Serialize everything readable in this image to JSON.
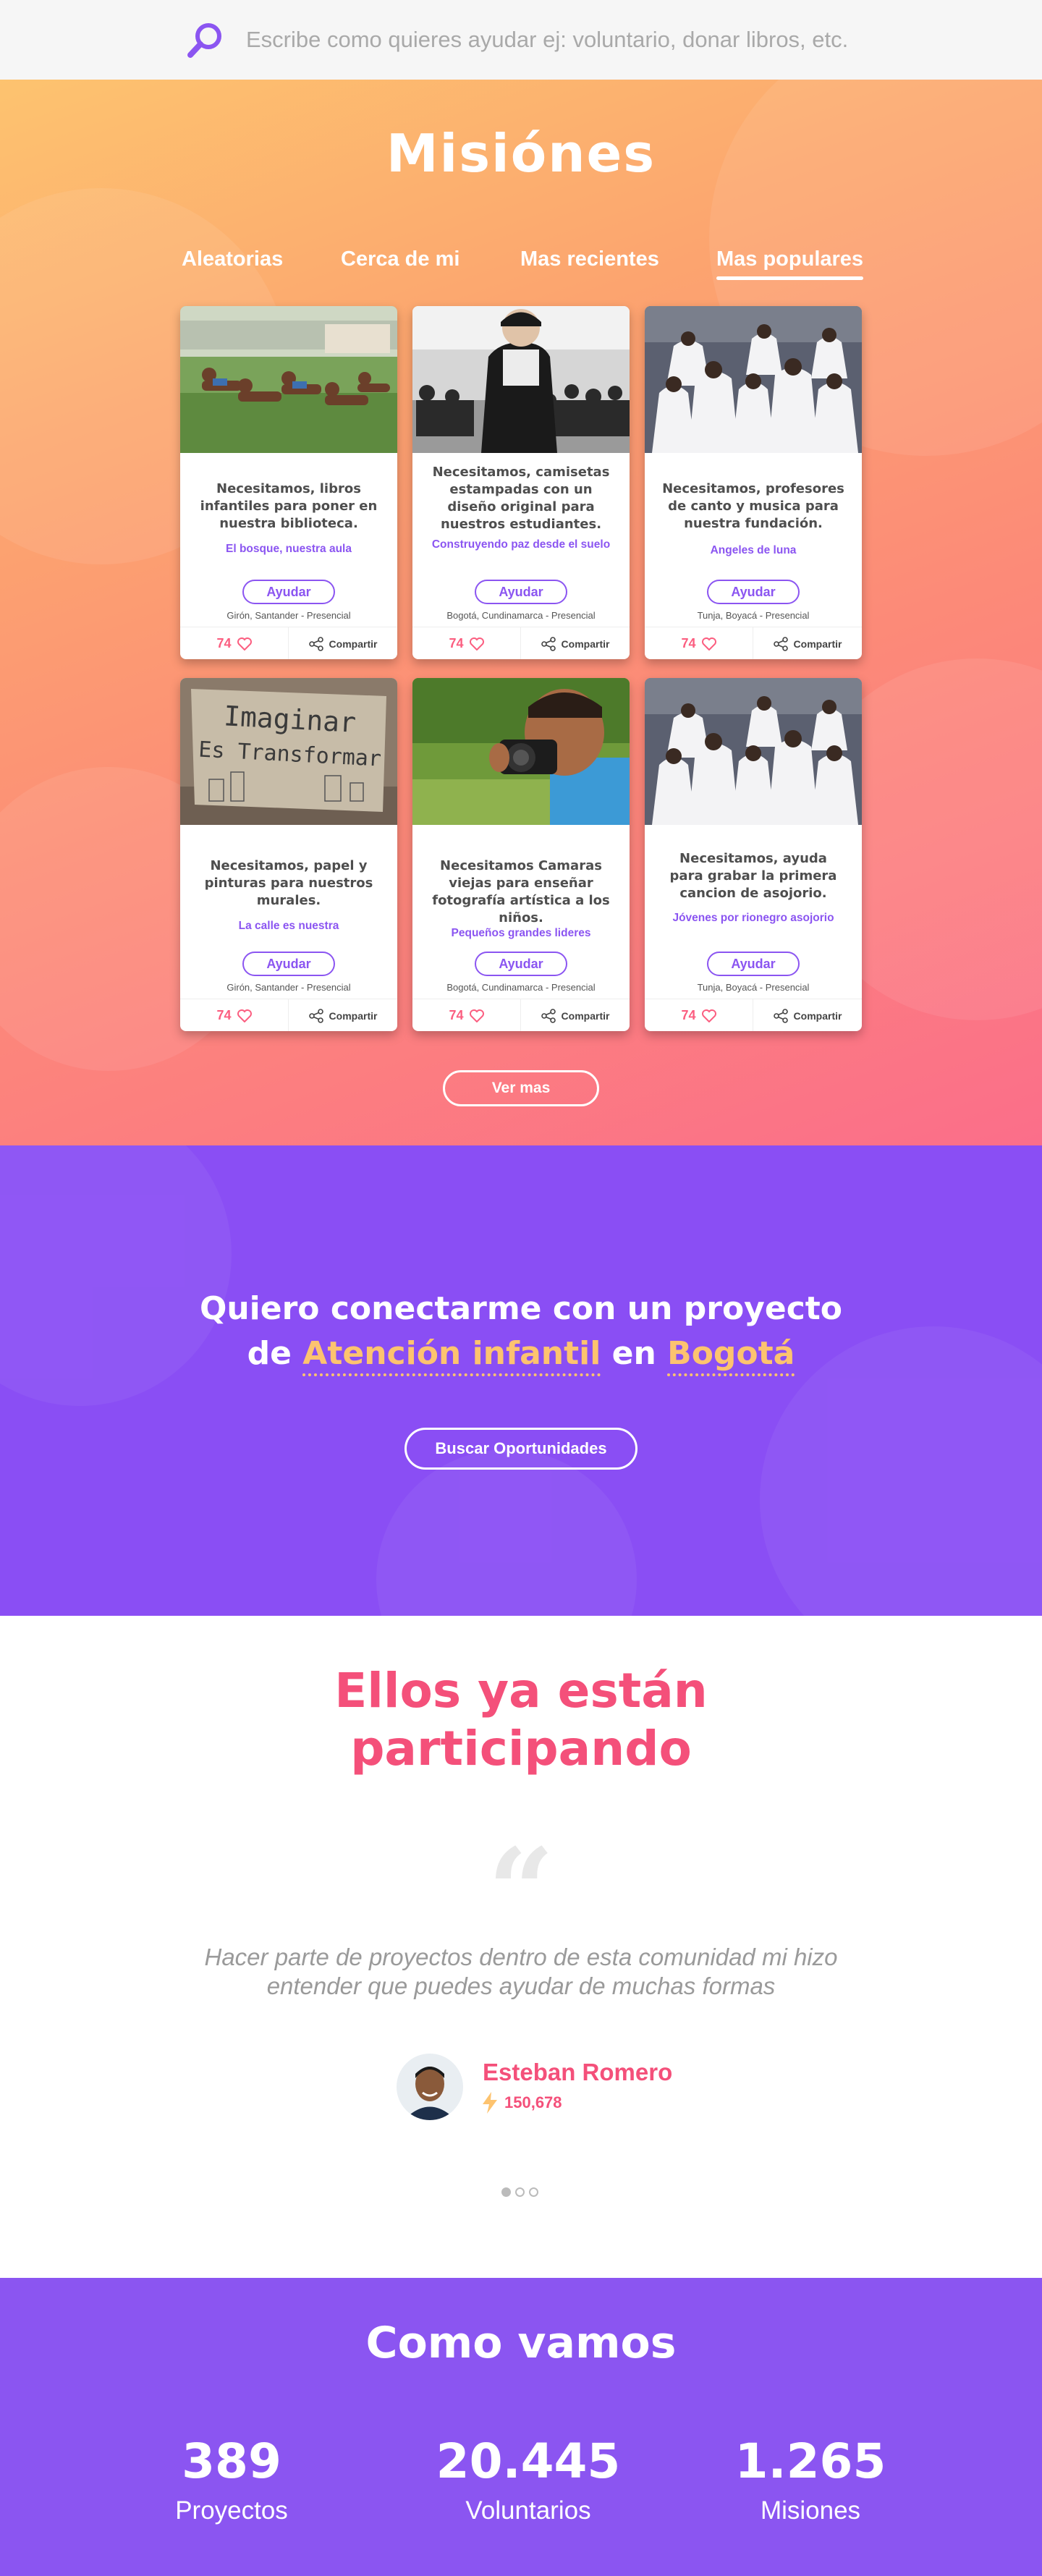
{
  "search": {
    "placeholder": "Escribe como quieres ayudar ej: voluntario, donar libros, etc."
  },
  "hero": {
    "title": "Misiónes",
    "tabs": [
      {
        "label": "Aleatorias"
      },
      {
        "label": "Cerca de mi"
      },
      {
        "label": "Mas recientes"
      },
      {
        "label": "Mas populares",
        "active": true
      }
    ],
    "cards": [
      {
        "title": "Necesitamos, libros infantiles  para poner en nuestra biblioteca.",
        "org": "El bosque, nuestra aula",
        "button": "Ayudar",
        "location": "Girón, Santander - Presencial",
        "likes": "74",
        "share": "Compartir"
      },
      {
        "title": "Necesitamos, camisetas estampadas con un diseño original para nuestros estudiantes.",
        "org": "Construyendo paz desde el suelo",
        "button": "Ayudar",
        "location": "Bogotá, Cundinamarca - Presencial",
        "likes": "74",
        "share": "Compartir"
      },
      {
        "title": "Necesitamos, profesores de canto y musica para nuestra fundación.",
        "org": "Angeles de luna",
        "button": "Ayudar",
        "location": "Tunja, Boyacá - Presencial",
        "likes": "74",
        "share": "Compartir"
      },
      {
        "title": "Necesitamos, papel y pinturas para nuestros murales.",
        "org": "La calle es nuestra",
        "button": "Ayudar",
        "location": "Girón, Santander - Presencial",
        "likes": "74",
        "share": "Compartir"
      },
      {
        "title": "Necesitamos Camaras viejas para enseñar fotografía artística a los niños.",
        "org": "Pequeños grandes lideres",
        "button": "Ayudar",
        "location": "Bogotá, Cundinamarca - Presencial",
        "likes": "74",
        "share": "Compartir"
      },
      {
        "title": "Necesitamos, ayuda para grabar la primera cancion de asojorio.",
        "org": "Jóvenes por rionegro asojorio",
        "button": "Ayudar",
        "location": "Tunja, Boyacá - Presencial",
        "likes": "74",
        "share": "Compartir"
      }
    ],
    "sign_text_1": "Imaginar",
    "sign_text_2": "Es Transformar",
    "ver_mas": "Ver mas"
  },
  "connect": {
    "line1": "Quiero conectarme con un proyecto",
    "line2_prefix": "de ",
    "category": "Atención infantil",
    "line2_middle": " en ",
    "city": "Bogotá",
    "button": "Buscar Oportunidades"
  },
  "testimonial": {
    "title_line1": "Ellos ya están",
    "title_line2": "participando",
    "quote_mark": "“",
    "quote": "Hacer parte de proyectos dentro de esta comunidad mi hizo entender que puedes ayudar de muchas formas",
    "name": "Esteban Romero",
    "points": "150,678"
  },
  "stats": {
    "title": "Como vamos",
    "items": [
      {
        "number": "389",
        "label": "Proyectos"
      },
      {
        "number": "20.445",
        "label": "Voluntarios"
      },
      {
        "number": "1.265",
        "label": "Misiones"
      }
    ]
  },
  "colors": {
    "purple": "#8b55f1",
    "pink": "#f4507a",
    "yellow": "#fdc36f",
    "orange": "#fca46f"
  }
}
